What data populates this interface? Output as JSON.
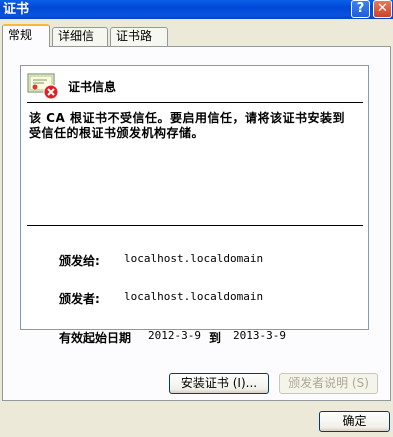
{
  "window": {
    "title": "证书",
    "help_glyph": "?",
    "close_glyph": "✕"
  },
  "tabs": [
    {
      "label": "常规",
      "active": true
    },
    {
      "label": "详细信息",
      "active": false
    },
    {
      "label": "证书路径",
      "active": false
    }
  ],
  "certificate": {
    "heading": "证书信息",
    "warning": "该 CA 根证书不受信任。要启用信任，请将该证书安装到受信任的根证书颁发机构存储。",
    "issued_to_label": "颁发给:",
    "issued_to": "localhost.localdomain",
    "issued_by_label": "颁发者:",
    "issued_by": "localhost.localdomain",
    "valid_label": "有效起始日期",
    "valid_from": "2012-3-9",
    "valid_to_label": "到",
    "valid_to": "2013-3-9"
  },
  "buttons": {
    "install": "安装证书 (I)...",
    "issuer_statement": "颁发者说明 (S)",
    "ok": "确定"
  },
  "colors": {
    "titlebar": "#0054e3",
    "dialog_bg": "#ece9d8",
    "tab_highlight": "#f8b838",
    "error_red": "#e02020"
  }
}
